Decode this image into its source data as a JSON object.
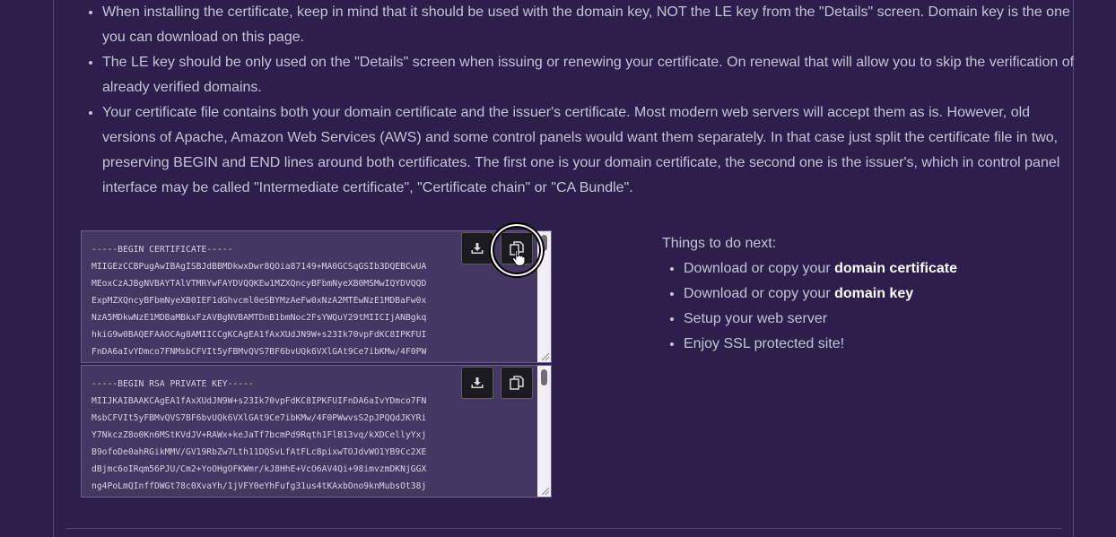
{
  "notes": [
    "When installing the certificate, keep in mind that it should be used with the domain key, NOT the LE key from the \"Details\" screen. Domain key is the one you can download on this page.",
    "The LE key should be only used on the \"Details\" screen when issuing or renewing your certificate. On renewal that will allow you to skip the verification of already verified domains.",
    "Your certificate file contains both your domain certificate and the issuer's certificate. Most modern web servers will accept them as is. However, old versions of Apache, Amazon Web Services (AWS) and some control panels would want them separately. In that case just split the certificate file in two, preserving BEGIN and END lines around both certificates. The first one is your domain certificate, the second one is the issuer's, which in control panel interface may be called \"Intermediate certificate\", \"Certificate chain\" or \"CA Bundle\"."
  ],
  "certificate_text": "-----BEGIN CERTIFICATE-----\nMIIGEzCCBPugAwIBAgISBJdBBMDkwxDwr8QOia87149+MA0GCSqGSIb3DQEBCwUA\nMEoxCzAJBgNVBAYTAlVTMRYwFAYDVQQKEw1MZXQncyBFbmNyeXB0MSMwIQYDVQQD\nExpMZXQncyBFbmNyeXB0IEF1dGhvcml0eSBYMzAeFw0xNzA2MTEwNzE1MDBaFw0x\nNzA5MDkwNzE1MDBaMBkxFzAVBgNVBAMTDnB1bmNoc2FsYWQuY29tMIICIjANBgkq\nhkiG9w0BAQEFAAOCAg8AMIICCgKCAgEA1fAxXUdJN9W+s23Ik70vpFdKC8IPKFUI\nFnDA6aIvYDmco7FNMsbCFVIt5yFBMvQVS7BF6bvUQk6VXlGAt9Ce7ibKMw/4F0PW",
  "key_text": "-----BEGIN RSA PRIVATE KEY-----\nMIIJKAIBAAKCAgEA1fAxXUdJN9W+s23Ik70vpFdKC8IPKFUIFnDA6aIvYDmco7FN\nMsbCFVIt5yFBMvQVS7BF6bvUQk6VXlGAt9Ce7ibKMw/4F0PWwvsS2pJPQQdJKYRi\nY7NkczZ8o0Kn6MStKVdJV+RAWx+keJaTf7bcmPd9Rqth1FlB13vq/kXDCellyYxj\nB9ofoDe0ahRGikMMV/GV19RbZw7Lth11DQSvLfAtFLc8pixwTOJdvWO1YB9Cc2XE\ndBjmc6oIRqm56PJU/Cm2+YoOHgOFKWmr/kJ8HhE+VcO6AV4Qi+98imvzmDKNjGGX\nng4PoLmQInffDWGt78c0XvaYh/1jVFY0eYhFufg31us4tKAxbOno9knMubsOt38j",
  "next": {
    "heading": "Things to do next:",
    "items": [
      {
        "prefix": "Download or copy your ",
        "strong": "domain certificate"
      },
      {
        "prefix": "Download or copy your ",
        "strong": "domain key"
      },
      {
        "prefix": "Setup your web server",
        "strong": ""
      },
      {
        "prefix": "Enjoy SSL protected site!",
        "strong": ""
      }
    ]
  },
  "icons": {
    "download": "download-icon",
    "copy": "copy-icon",
    "cursor": "hand-pointer-icon"
  }
}
